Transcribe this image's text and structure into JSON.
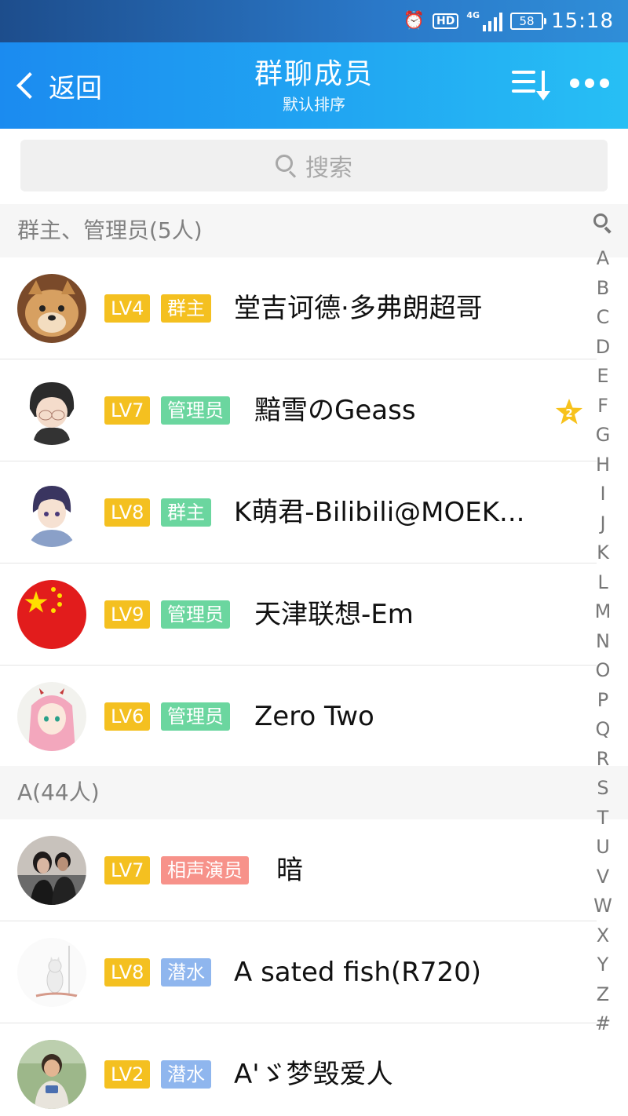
{
  "status_bar": {
    "alarm_icon": "alarm-clock-icon",
    "hd_label": "HD",
    "network_label": "4G",
    "battery": "58",
    "time": "15:18"
  },
  "header": {
    "back_label": "返回",
    "title": "群聊成员",
    "subtitle": "默认排序",
    "sort_icon": "sort-icon",
    "more_icon": "more-icon"
  },
  "search": {
    "placeholder": "搜索"
  },
  "sections": [
    {
      "title": "群主、管理员(5人)"
    },
    {
      "title": "A(44人)"
    }
  ],
  "members": [
    {
      "level": "LV4",
      "role": "群主",
      "role_color": "#f4c020",
      "name": "堂吉诃德·多弗朗超哥",
      "avatar": "shiba-dog-avatar"
    },
    {
      "level": "LV7",
      "role": "管理员",
      "role_color": "#6bd69f",
      "name": "黯雪のGeass",
      "avatar": "anime-boy-avatar",
      "star_label": "2"
    },
    {
      "level": "LV8",
      "role": "群主",
      "role_color": "#6bd69f",
      "name": "K萌君-Bilibili@MOEK...",
      "avatar": "anime-girl-avatar"
    },
    {
      "level": "LV9",
      "role": "管理员",
      "role_color": "#6bd69f",
      "name": "天津联想-Em",
      "avatar": "china-flag-avatar"
    },
    {
      "level": "LV6",
      "role": "管理员",
      "role_color": "#6bd69f",
      "name": "Zero Two",
      "avatar": "zero-two-avatar"
    },
    {
      "level": "LV7",
      "role": "相声演员",
      "role_color": "#f7928a",
      "name": "暗",
      "avatar": "couple-photo-avatar"
    },
    {
      "level": "LV8",
      "role": "潜水",
      "role_color": "#8fb6ee",
      "name": "A sated fish(R720)",
      "avatar": "white-cat-avatar"
    },
    {
      "level": "LV2",
      "role": "潜水",
      "role_color": "#8fb6ee",
      "name": "A'ゞ梦毁爱人",
      "avatar": "child-photo-avatar"
    }
  ],
  "index_bar": [
    "A",
    "B",
    "C",
    "D",
    "E",
    "F",
    "G",
    "H",
    "I",
    "J",
    "K",
    "L",
    "M",
    "N",
    "O",
    "P",
    "Q",
    "R",
    "S",
    "T",
    "U",
    "V",
    "W",
    "X",
    "Y",
    "Z",
    "#"
  ]
}
